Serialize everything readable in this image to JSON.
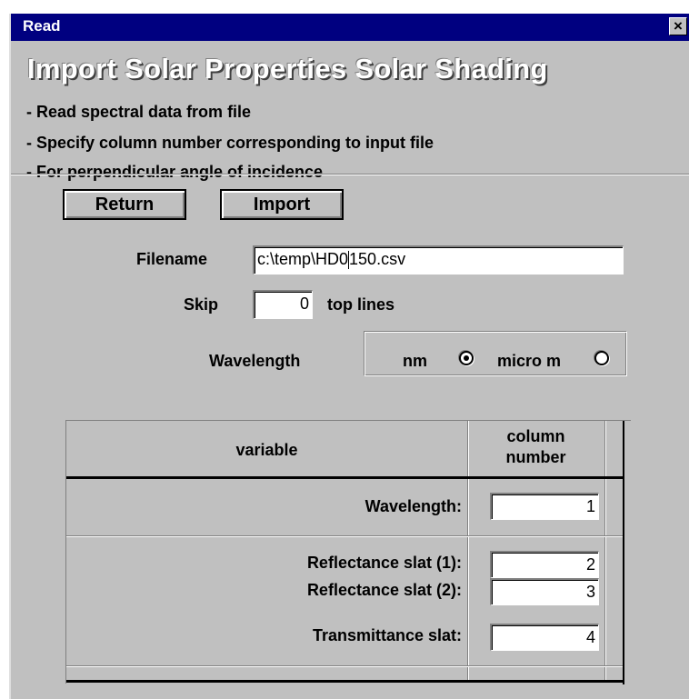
{
  "window": {
    "title": "Read",
    "close_label": "×"
  },
  "header": {
    "main_title": "Import Solar Properties Solar Shading",
    "bullets": [
      "- Read spectral data from file",
      "- Specify column number corresponding to input file",
      "- For perpendicular angle of incidence"
    ]
  },
  "toolbar": {
    "return_label": "Return",
    "import_label": "Import"
  },
  "form": {
    "filename_label": "Filename",
    "filename_value_before_caret": "c:\\temp\\HD0",
    "filename_value_after_caret": "150.csv",
    "skip_label": "Skip",
    "skip_value": "0",
    "skip_suffix": "top lines",
    "wavelength_label": "Wavelength",
    "unit_nm_label": "nm",
    "unit_micro_label": "micro m",
    "selected_unit": "nm"
  },
  "table": {
    "col_variable": "variable",
    "col_number_line1": "column",
    "col_number_line2": "number",
    "rows": [
      {
        "label": "Wavelength:",
        "value": "1"
      },
      {
        "label": "Reflectance slat  (1):",
        "value": "2"
      },
      {
        "label": "Reflectance slat  (2):",
        "value": "3"
      },
      {
        "label": "Transmittance slat:",
        "value": "4"
      }
    ]
  }
}
